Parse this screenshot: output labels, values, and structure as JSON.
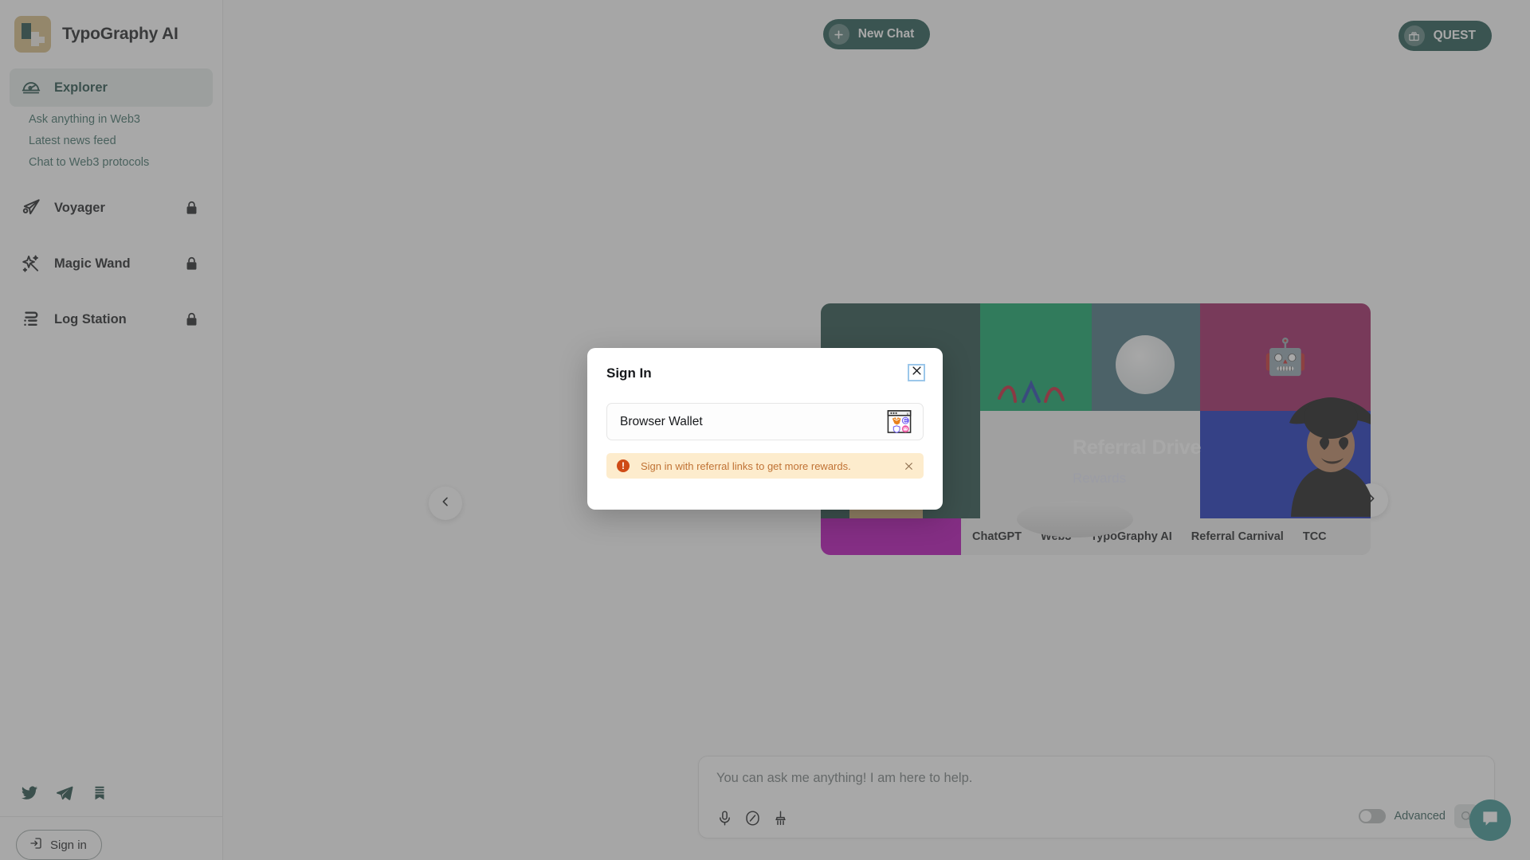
{
  "app": {
    "brand_title": "TypoGraphy AI"
  },
  "sidebar": {
    "items": [
      {
        "label": "Explorer",
        "icon": "explorer-icon",
        "active": true,
        "locked": false
      },
      {
        "label": "Voyager",
        "icon": "paper-plane-icon",
        "active": false,
        "locked": true
      },
      {
        "label": "Magic Wand",
        "icon": "sparkle-icon",
        "active": false,
        "locked": true
      },
      {
        "label": "Log Station",
        "icon": "log-list-icon",
        "active": false,
        "locked": true
      }
    ],
    "sub_links": [
      "Ask anything in Web3",
      "Latest news feed",
      "Chat to Web3 protocols"
    ],
    "socials": [
      "twitter-icon",
      "telegram-icon",
      "mirror-icon"
    ],
    "sign_in_label": "Sign in"
  },
  "topbar": {
    "new_chat_label": "New Chat",
    "new_chat_icon": "plus-circle-icon",
    "quest_label": "QUEST",
    "quest_icon": "gift-icon"
  },
  "carousel": {
    "prev_icon": "chevron-left-icon",
    "next_icon": "chevron-right-icon",
    "banner": {
      "title": "Referral Drive",
      "subtitle": "Rewards",
      "robot_emoji": "🤖",
      "tags": [
        "ChatGPT",
        "Web3",
        "TypoGraphy AI",
        "Referral Carnival",
        "TCC"
      ],
      "colors": {
        "teal": "#1e4741",
        "green": "#07a160",
        "slate": "#3f6d79",
        "magenta": "#9b1b5c",
        "blue": "#1028b8",
        "purple": "#b500b5"
      }
    }
  },
  "composer": {
    "placeholder": "You can ask me anything! I am here to help.",
    "tools": [
      "microphone-icon",
      "slash-circle-icon",
      "brush-icon"
    ],
    "advanced_label": "Advanced",
    "advanced_on": false,
    "send_icon": "send-icon"
  },
  "chat_fab": {
    "icon": "chat-bubble-icon"
  },
  "modal": {
    "title": "Sign In",
    "close_icon": "close-icon",
    "wallet_option": {
      "name": "Browser Wallet",
      "icon": "browser-wallet-icon"
    },
    "alert": {
      "icon": "exclamation-icon",
      "text": "Sign in with referral links to get more rewards.",
      "close_icon": "close-icon"
    }
  },
  "theme": {
    "accent": "#1b5049",
    "accent_light": "#e6ecea",
    "brand_gold": "#d5bb7f",
    "alert_bg": "#fdeccd",
    "alert_fg": "#c07234"
  }
}
